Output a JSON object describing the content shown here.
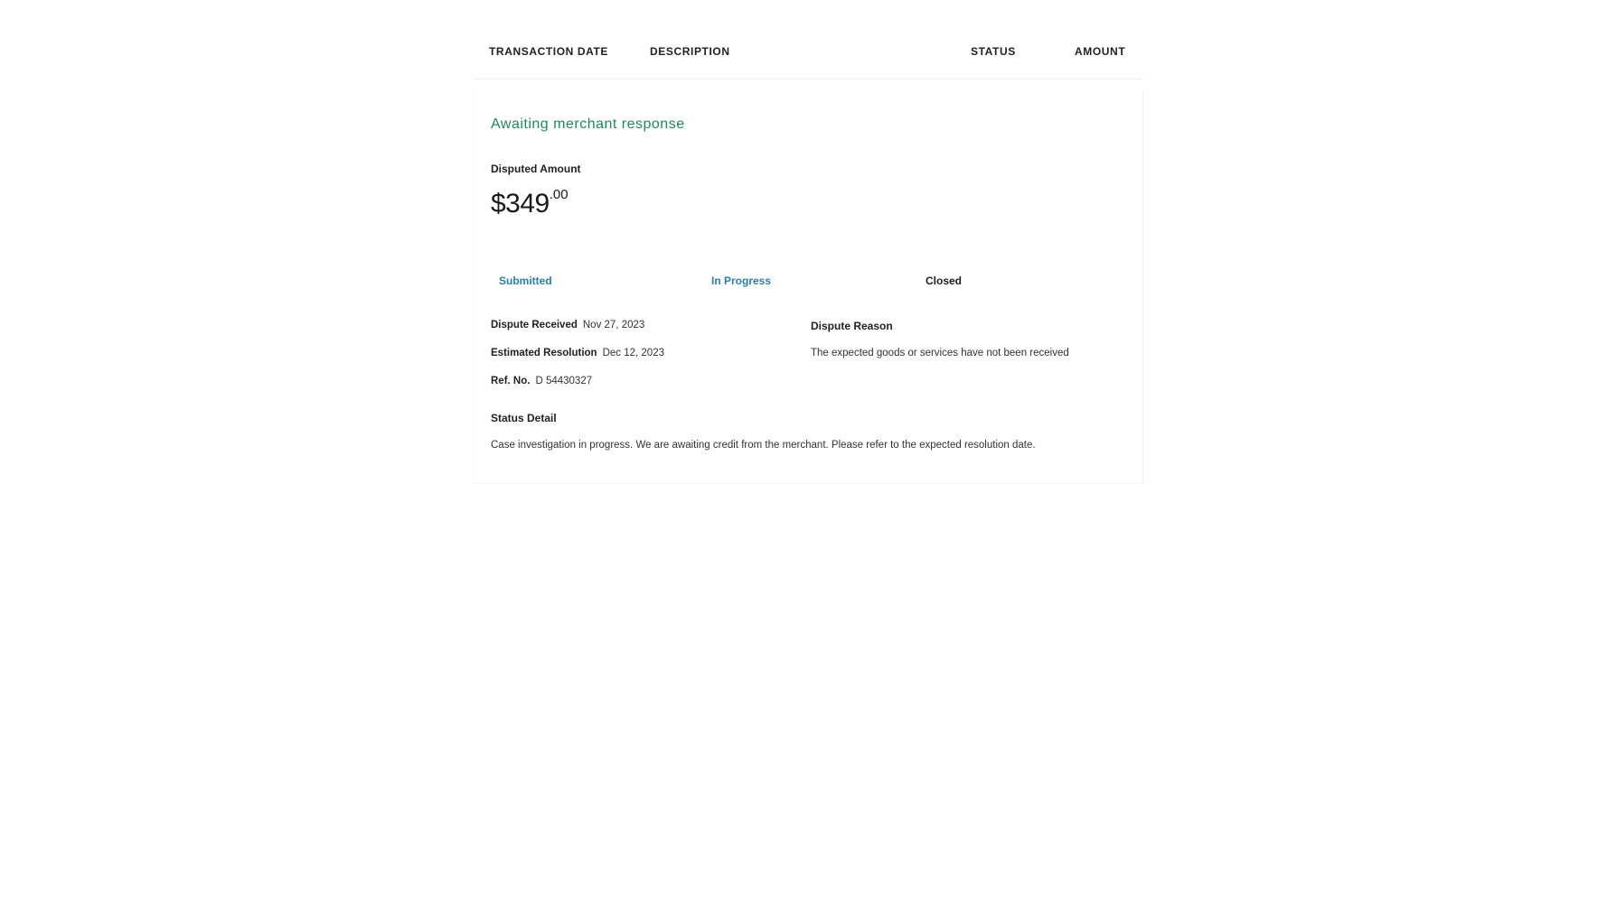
{
  "table_header": {
    "transaction_date": "TRANSACTION DATE",
    "description": "DESCRIPTION",
    "status": "STATUS",
    "amount": "AMOUNT"
  },
  "dispute": {
    "headline": "Awaiting merchant response",
    "disputed_amount_label": "Disputed Amount",
    "amount_dollars": "$349",
    "amount_cents": ".00",
    "steps": [
      "Submitted",
      "In Progress",
      "Closed"
    ],
    "received_label": "Dispute Received",
    "received_value": "Nov 27, 2023",
    "resolution_label": "Estimated Resolution",
    "resolution_value": "Dec 12, 2023",
    "ref_label": "Ref. No.",
    "ref_value": "D 54430327",
    "reason_label": "Dispute Reason",
    "reason_value": "The expected goods or services have not been received",
    "status_detail_label": "Status Detail",
    "status_detail_value": "Case investigation in progress. We are awaiting credit from the merchant. Please refer to the expected resolution date."
  },
  "colors": {
    "headline": "#1e8a5a",
    "active_step": "#2a7fae"
  }
}
